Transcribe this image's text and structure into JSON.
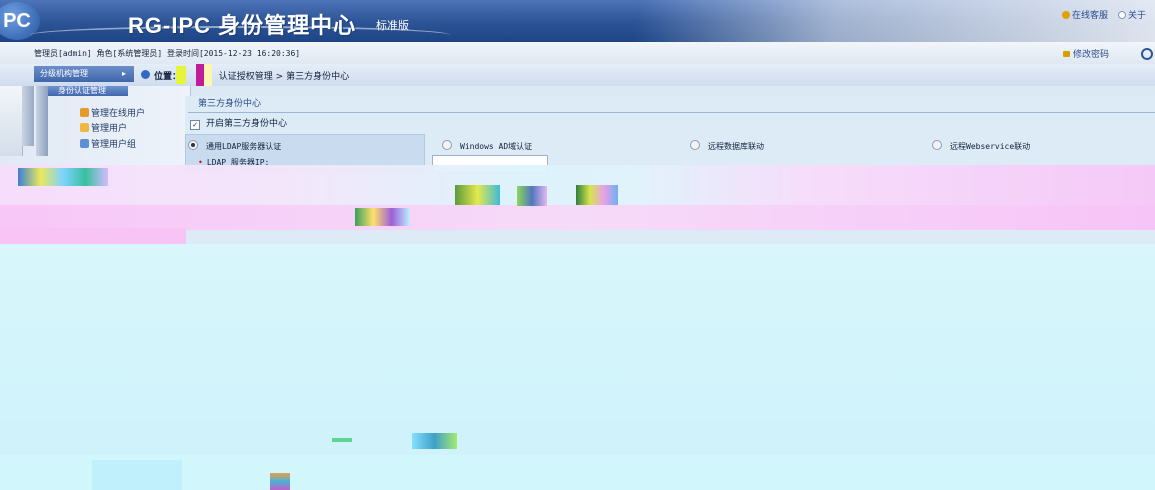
{
  "header": {
    "logo_text": "PC",
    "title": "RG-IPC 身份管理中心",
    "edition": "标准版",
    "links": [
      {
        "label": "在线客服",
        "icon": "support-icon"
      },
      {
        "label": "关于",
        "icon": "info-icon"
      }
    ]
  },
  "status": {
    "admin_info": "管理员[admin] 角色[系统管理员] 登录时间[2015-12-23 16:20:36]",
    "change_password": "修改密码"
  },
  "nav": {
    "menu_tab": "分级机构管理",
    "menu_arrow": "▸",
    "breadcrumb_prefix": "位置：",
    "breadcrumb_mid": "认证授权管理",
    "breadcrumb_sep": ">",
    "breadcrumb_current": "第三方身份中心"
  },
  "sidebar": {
    "active_item": "身份认证管理",
    "items": [
      {
        "label": "管理在线用户",
        "icon": "online-users-icon"
      },
      {
        "label": "管理用户",
        "icon": "user-icon"
      },
      {
        "label": "管理用户组",
        "icon": "user-group-icon"
      }
    ]
  },
  "content": {
    "tab_label": "第三方身份中心",
    "enable_label": "开启第三方身份中心",
    "options": [
      {
        "label": "通用LDAP服务器认证",
        "selected": true
      },
      {
        "label": "Windows AD域认证",
        "selected": false
      },
      {
        "label": "远程数据库联动",
        "selected": false
      },
      {
        "label": "远程Webservice联动",
        "selected": false
      }
    ],
    "ldap_ip_label": "LDAP 服务器IP:",
    "ldap_ip_value": ""
  },
  "colors": {
    "header_blue": "#2e5597",
    "accent": "#4268ad",
    "required": "#c4001b"
  }
}
